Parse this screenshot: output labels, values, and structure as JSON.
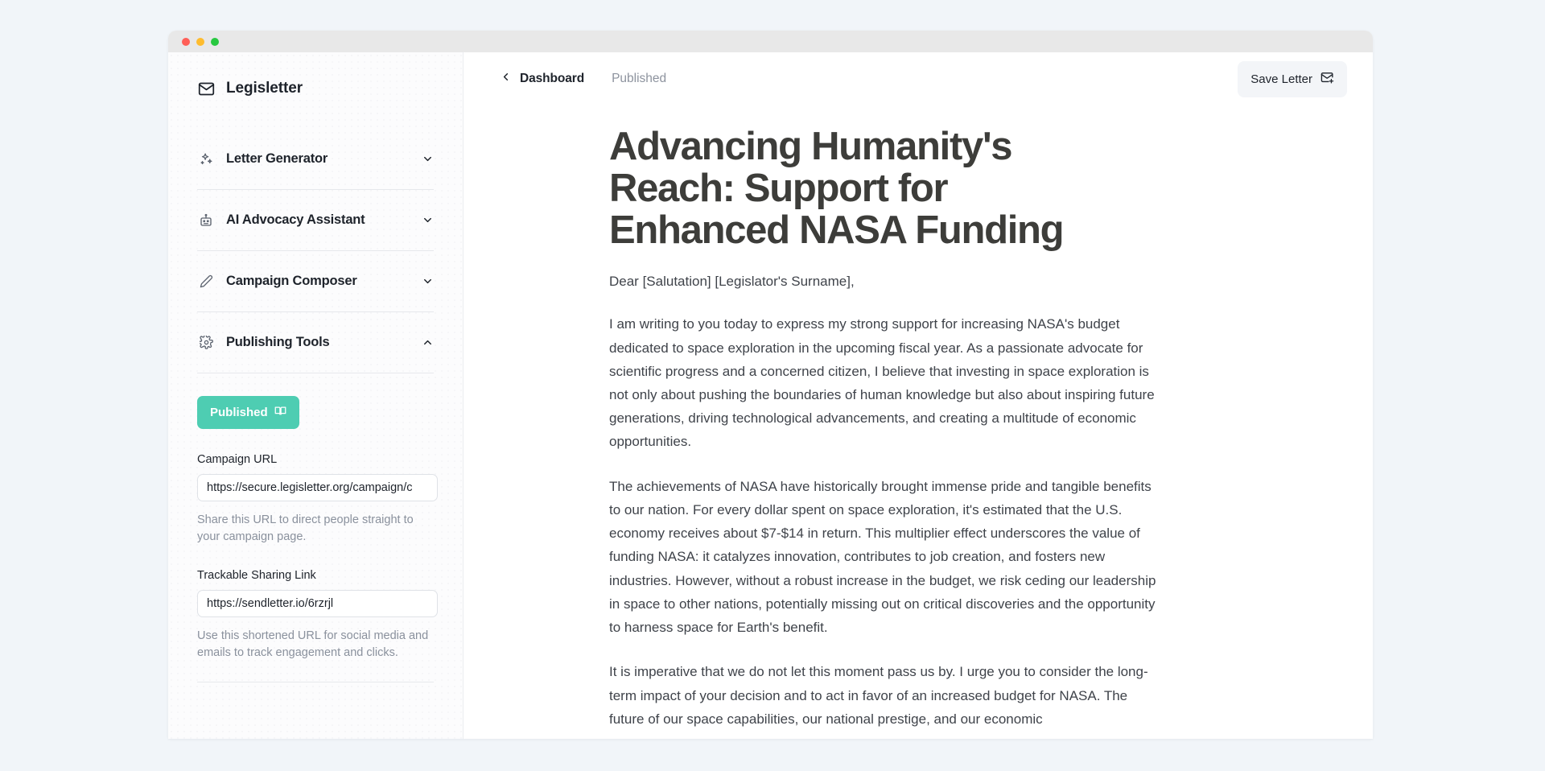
{
  "window": {
    "traffic_lights": [
      "close",
      "minimize",
      "maximize"
    ]
  },
  "sidebar": {
    "brand": {
      "name": "Legisletter",
      "icon": "envelope-icon"
    },
    "nav_items": [
      {
        "label": "Letter Generator",
        "icon": "sparkles-icon",
        "chevron": "chevron-down-icon",
        "expanded": false
      },
      {
        "label": "AI Advocacy Assistant",
        "icon": "robot-icon",
        "chevron": "chevron-down-icon",
        "expanded": false
      },
      {
        "label": "Campaign Composer",
        "icon": "pencil-icon",
        "chevron": "chevron-down-icon",
        "expanded": false
      },
      {
        "label": "Publishing Tools",
        "icon": "gear-icon",
        "chevron": "chevron-up-icon",
        "expanded": true
      }
    ],
    "publishing": {
      "status_badge": {
        "label": "Published",
        "icon": "book-open-icon",
        "color": "#4ecdb2",
        "text_color": "#ffffff"
      },
      "campaign_url": {
        "label": "Campaign URL",
        "value": "https://secure.legisletter.org/campaign/c",
        "help": "Share this URL to direct people straight to your campaign page."
      },
      "trackable_link": {
        "label": "Trackable Sharing Link",
        "value": "https://sendletter.io/6rzrjl",
        "help": "Use this shortened URL for social media and emails to track engagement and clicks."
      }
    }
  },
  "topbar": {
    "back_icon": "chevron-left-icon",
    "breadcrumb_back": "Dashboard",
    "breadcrumb_current": "Published",
    "save_button": {
      "label": "Save Letter",
      "icon": "envelope-plus-icon"
    }
  },
  "letter": {
    "title": "Advancing Humanity's Reach: Support for Enhanced NASA Funding",
    "salutation": "Dear [Salutation] [Legislator's Surname],",
    "paragraphs": [
      "I am writing to you today to express my strong support for increasing NASA's budget dedicated to space exploration in the upcoming fiscal year. As a passionate advocate for scientific progress and a concerned citizen, I believe that investing in space exploration is not only about pushing the boundaries of human knowledge but also about inspiring future generations, driving technological advancements, and creating a multitude of economic opportunities.",
      "The achievements of NASA have historically brought immense pride and tangible benefits to our nation. For every dollar spent on space exploration, it's estimated that the U.S. economy receives about $7-$14 in return. This multiplier effect underscores the value of funding NASA: it catalyzes innovation, contributes to job creation, and fosters new industries. However, without a robust increase in the budget, we risk ceding our leadership in space to other nations, potentially missing out on critical discoveries and the opportunity to harness space for Earth's benefit.",
      "It is imperative that we do not let this moment pass us by. I urge you to consider the long-term impact of your decision and to act in favor of an increased budget for NASA. The future of our space capabilities, our national prestige, and our economic"
    ]
  },
  "colors": {
    "page_background": "#f1f5f9",
    "accent": "#4ecdb2",
    "title_text": "#3d3d3a",
    "body_text": "#3f434a",
    "muted_text": "#8a919d"
  }
}
